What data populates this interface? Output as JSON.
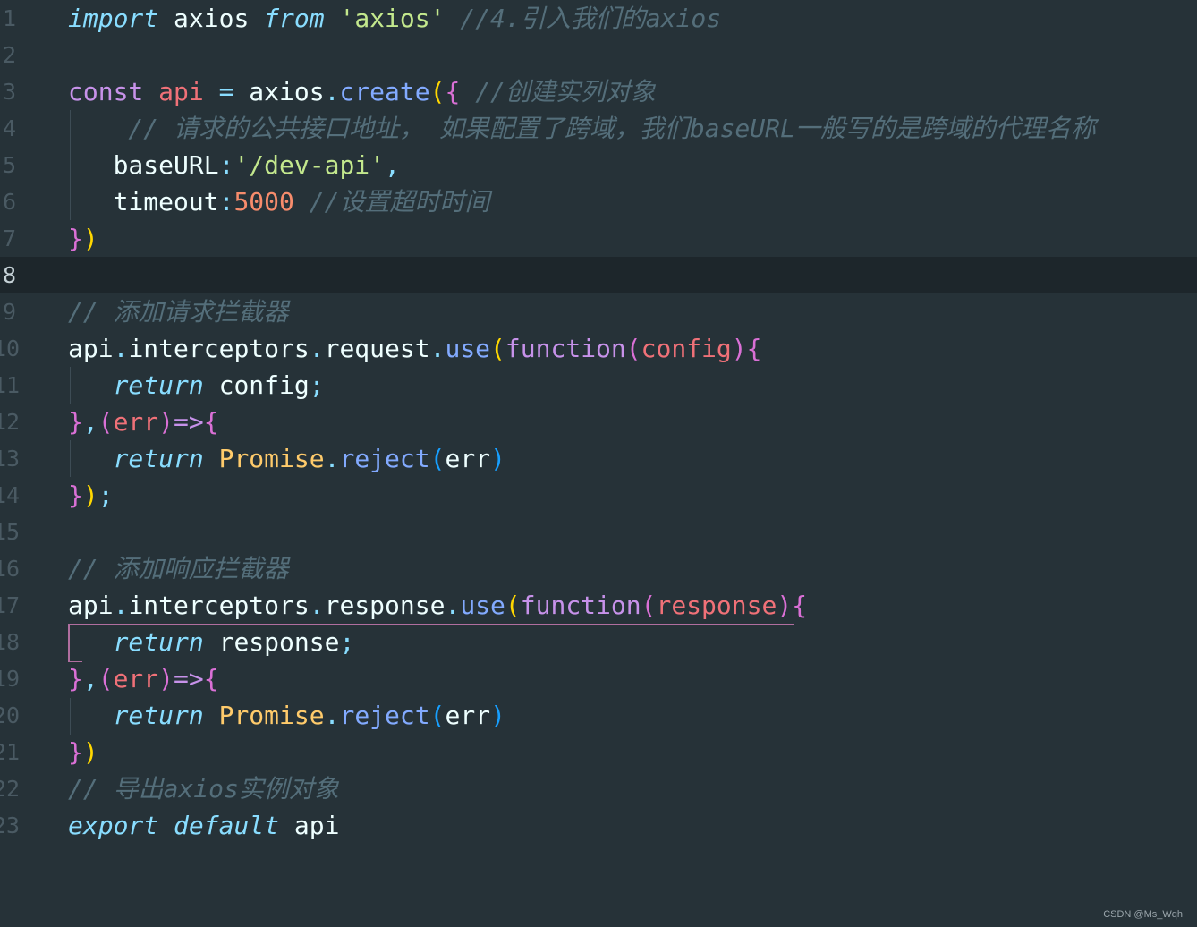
{
  "editor": {
    "current_line": "8",
    "lines": [
      {
        "num": "1",
        "tokens": [
          {
            "t": "import",
            "c": "kw-i"
          },
          {
            "t": " axios ",
            "c": "plain"
          },
          {
            "t": "from",
            "c": "kw-i"
          },
          {
            "t": " ",
            "c": "plain"
          },
          {
            "t": "'axios'",
            "c": "str"
          },
          {
            "t": " //4.引入我们的axios",
            "c": "cm"
          }
        ]
      },
      {
        "num": "2",
        "tokens": []
      },
      {
        "num": "3",
        "tokens": [
          {
            "t": "const",
            "c": "kw"
          },
          {
            "t": " ",
            "c": "plain"
          },
          {
            "t": "api",
            "c": "var"
          },
          {
            "t": " ",
            "c": "plain"
          },
          {
            "t": "=",
            "c": "op"
          },
          {
            "t": " axios",
            "c": "plain"
          },
          {
            "t": ".",
            "c": "op"
          },
          {
            "t": "create",
            "c": "fn"
          },
          {
            "t": "(",
            "c": "b1"
          },
          {
            "t": "{",
            "c": "b2"
          },
          {
            "t": " //创建实列对象",
            "c": "cm"
          }
        ]
      },
      {
        "num": "4",
        "tokens": [
          {
            "t": "    // 请求的公共接口地址， 如果配置了跨域，我们baseURL一般写的是跨域的代理名称",
            "c": "cm"
          }
        ]
      },
      {
        "num": "5",
        "tokens": [
          {
            "t": "   baseURL",
            "c": "plain"
          },
          {
            "t": ":",
            "c": "op"
          },
          {
            "t": "'/dev-api'",
            "c": "str"
          },
          {
            "t": ",",
            "c": "op"
          }
        ]
      },
      {
        "num": "6",
        "tokens": [
          {
            "t": "   timeout",
            "c": "plain"
          },
          {
            "t": ":",
            "c": "op"
          },
          {
            "t": "5000",
            "c": "num"
          },
          {
            "t": " //设置超时时间",
            "c": "cm"
          }
        ]
      },
      {
        "num": "7",
        "tokens": [
          {
            "t": "}",
            "c": "b2"
          },
          {
            "t": ")",
            "c": "b1"
          }
        ]
      },
      {
        "num": "8",
        "tokens": []
      },
      {
        "num": "9",
        "tokens": [
          {
            "t": "// 添加请求拦截器",
            "c": "cm"
          }
        ]
      },
      {
        "num": "10",
        "tokens": [
          {
            "t": "api",
            "c": "plain"
          },
          {
            "t": ".",
            "c": "op"
          },
          {
            "t": "interceptors",
            "c": "plain"
          },
          {
            "t": ".",
            "c": "op"
          },
          {
            "t": "request",
            "c": "plain"
          },
          {
            "t": ".",
            "c": "op"
          },
          {
            "t": "use",
            "c": "fn"
          },
          {
            "t": "(",
            "c": "b1"
          },
          {
            "t": "function",
            "c": "kw"
          },
          {
            "t": "(",
            "c": "b2"
          },
          {
            "t": "config",
            "c": "var"
          },
          {
            "t": ")",
            "c": "b2"
          },
          {
            "t": "{",
            "c": "b2"
          }
        ]
      },
      {
        "num": "11",
        "tokens": [
          {
            "t": "   ",
            "c": "plain"
          },
          {
            "t": "return",
            "c": "kw-i"
          },
          {
            "t": " config",
            "c": "plain"
          },
          {
            "t": ";",
            "c": "op"
          }
        ]
      },
      {
        "num": "12",
        "tokens": [
          {
            "t": "}",
            "c": "b2"
          },
          {
            "t": ",",
            "c": "op"
          },
          {
            "t": "(",
            "c": "b2"
          },
          {
            "t": "err",
            "c": "var"
          },
          {
            "t": ")",
            "c": "b2"
          },
          {
            "t": "=>",
            "c": "kw"
          },
          {
            "t": "{",
            "c": "b2"
          }
        ]
      },
      {
        "num": "13",
        "tokens": [
          {
            "t": "   ",
            "c": "plain"
          },
          {
            "t": "return",
            "c": "kw-i"
          },
          {
            "t": " ",
            "c": "plain"
          },
          {
            "t": "Promise",
            "c": "cls"
          },
          {
            "t": ".",
            "c": "op"
          },
          {
            "t": "reject",
            "c": "fn"
          },
          {
            "t": "(",
            "c": "b3"
          },
          {
            "t": "err",
            "c": "plain"
          },
          {
            "t": ")",
            "c": "b3"
          }
        ]
      },
      {
        "num": "14",
        "tokens": [
          {
            "t": "}",
            "c": "b2"
          },
          {
            "t": ")",
            "c": "b1"
          },
          {
            "t": ";",
            "c": "op"
          }
        ]
      },
      {
        "num": "15",
        "tokens": []
      },
      {
        "num": "16",
        "tokens": [
          {
            "t": "// 添加响应拦截器",
            "c": "cm"
          }
        ]
      },
      {
        "num": "17",
        "tokens": [
          {
            "t": "api",
            "c": "plain"
          },
          {
            "t": ".",
            "c": "op"
          },
          {
            "t": "interceptors",
            "c": "plain"
          },
          {
            "t": ".",
            "c": "op"
          },
          {
            "t": "response",
            "c": "plain"
          },
          {
            "t": ".",
            "c": "op"
          },
          {
            "t": "use",
            "c": "fn"
          },
          {
            "t": "(",
            "c": "b1"
          },
          {
            "t": "function",
            "c": "kw"
          },
          {
            "t": "(",
            "c": "b2"
          },
          {
            "t": "response",
            "c": "var"
          },
          {
            "t": ")",
            "c": "b2"
          },
          {
            "t": "{",
            "c": "b2"
          }
        ]
      },
      {
        "num": "18",
        "tokens": [
          {
            "t": "   ",
            "c": "plain"
          },
          {
            "t": "return",
            "c": "kw-i"
          },
          {
            "t": " response",
            "c": "plain"
          },
          {
            "t": ";",
            "c": "op"
          }
        ]
      },
      {
        "num": "19",
        "tokens": [
          {
            "t": "}",
            "c": "b2"
          },
          {
            "t": ",",
            "c": "op"
          },
          {
            "t": "(",
            "c": "b2"
          },
          {
            "t": "err",
            "c": "var"
          },
          {
            "t": ")",
            "c": "b2"
          },
          {
            "t": "=>",
            "c": "kw"
          },
          {
            "t": "{",
            "c": "b2"
          }
        ]
      },
      {
        "num": "20",
        "tokens": [
          {
            "t": "   ",
            "c": "plain"
          },
          {
            "t": "return",
            "c": "kw-i"
          },
          {
            "t": " ",
            "c": "plain"
          },
          {
            "t": "Promise",
            "c": "cls"
          },
          {
            "t": ".",
            "c": "op"
          },
          {
            "t": "reject",
            "c": "fn"
          },
          {
            "t": "(",
            "c": "b3"
          },
          {
            "t": "err",
            "c": "plain"
          },
          {
            "t": ")",
            "c": "b3"
          }
        ]
      },
      {
        "num": "21",
        "tokens": [
          {
            "t": "}",
            "c": "b2"
          },
          {
            "t": ")",
            "c": "b1"
          }
        ]
      },
      {
        "num": "22",
        "tokens": [
          {
            "t": "// 导出axios实例对象",
            "c": "cm"
          }
        ]
      },
      {
        "num": "23",
        "tokens": [
          {
            "t": "export",
            "c": "kw-i"
          },
          {
            "t": " ",
            "c": "plain"
          },
          {
            "t": "default",
            "c": "kw-i"
          },
          {
            "t": " api",
            "c": "plain"
          }
        ]
      }
    ]
  },
  "watermark": "CSDN @Ms_Wqh"
}
